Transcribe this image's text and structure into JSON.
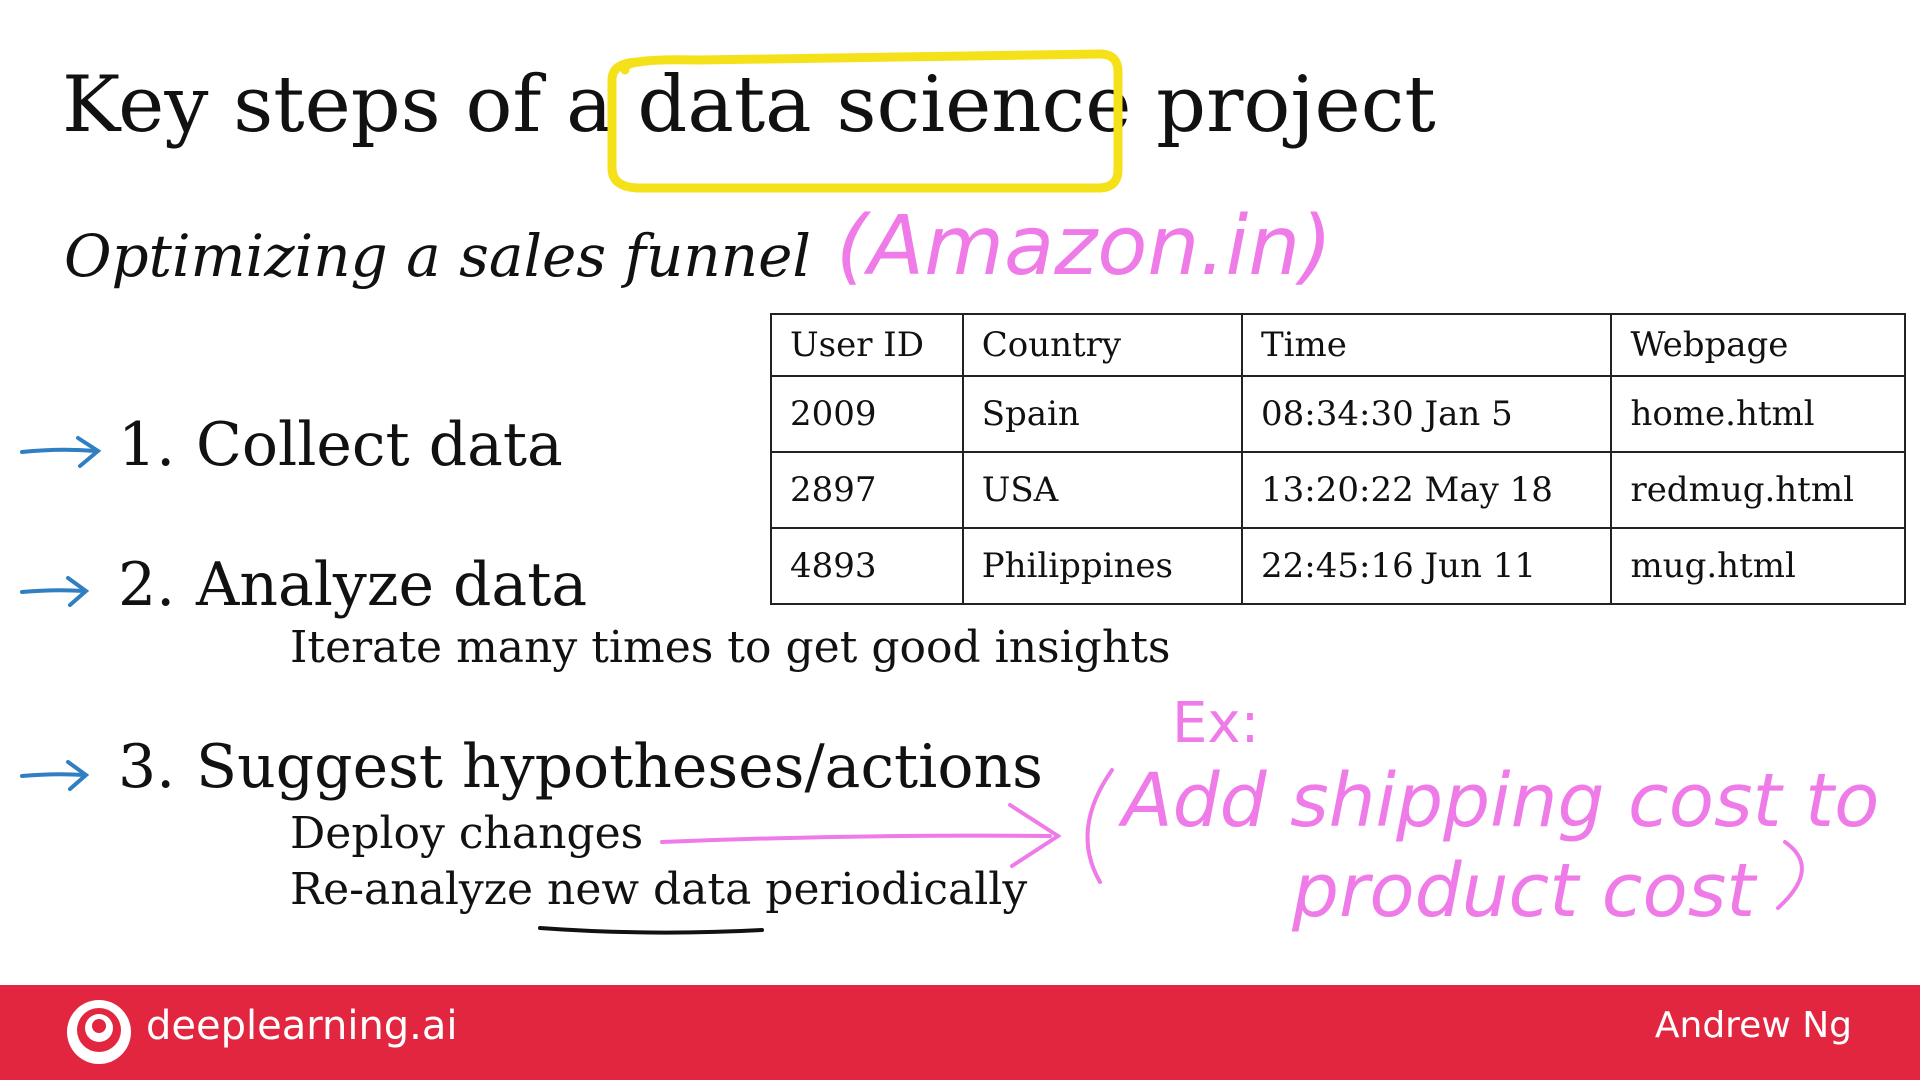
{
  "slide": {
    "title_before": "Key steps of a ",
    "title_highlight": "data science",
    "title_after": " project",
    "subtitle": "Optimizing a sales funnel",
    "steps": [
      {
        "number": "1.",
        "label": "Collect data",
        "details": []
      },
      {
        "number": "2.",
        "label": "Analyze data",
        "details": [
          "Iterate many times to get good insights"
        ]
      },
      {
        "number": "3.",
        "label": "Suggest hypotheses/actions",
        "details": [
          "Deploy changes",
          "Re-analyze new data periodically"
        ]
      }
    ],
    "table": {
      "headers": [
        "User ID",
        "Country",
        "Time",
        "Webpage"
      ],
      "rows": [
        [
          "2009",
          "Spain",
          "08:34:30 Jan 5",
          "home.html"
        ],
        [
          "2897",
          "USA",
          "13:20:22 May 18",
          "redmug.html"
        ],
        [
          "4893",
          "Philippines",
          "22:45:16 Jun 11",
          "mug.html"
        ]
      ]
    }
  },
  "annotations": {
    "site_note": "(Amazon.in)",
    "example_label": "Ex:",
    "example_line1": "Add shipping cost to",
    "example_line2": "product cost",
    "ink_color": "#ef7be8",
    "arrow_color": "#2f7fc2"
  },
  "footer": {
    "brand": "deeplearning.ai",
    "author": "Andrew Ng",
    "logo_icon": "deeplearning-logo-icon",
    "background": "#e3263f"
  }
}
